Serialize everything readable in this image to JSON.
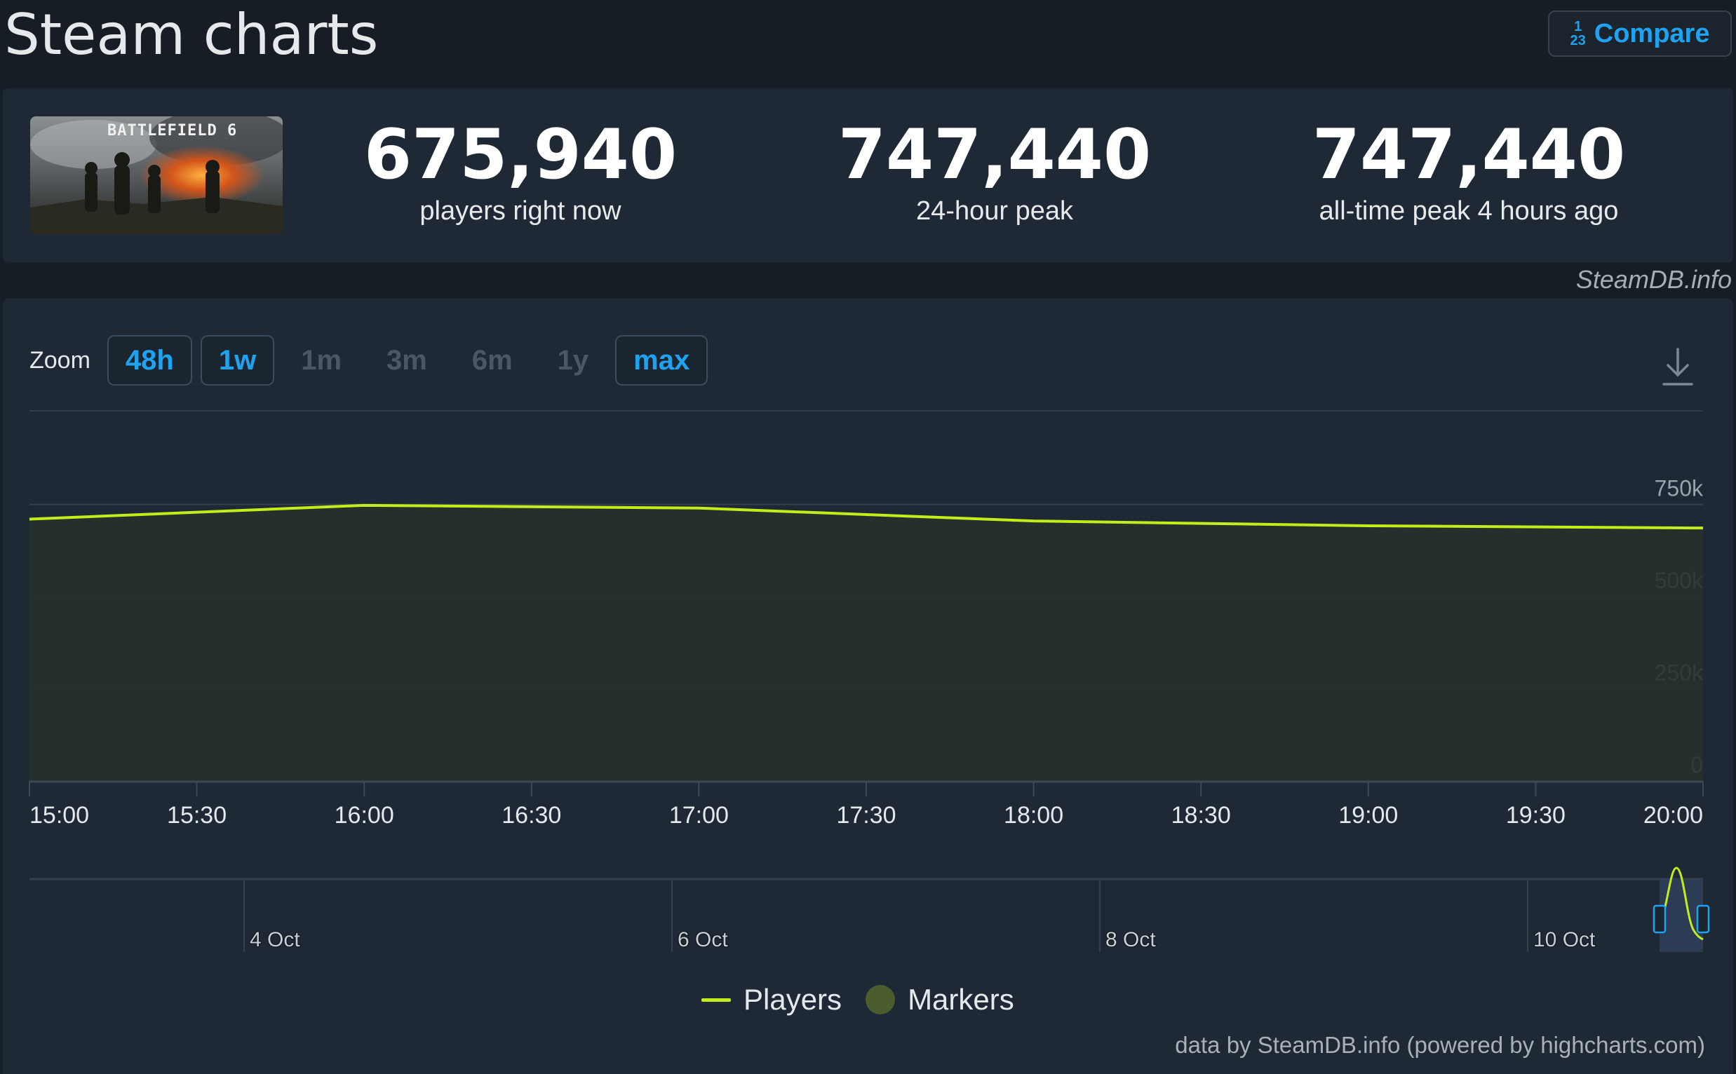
{
  "header": {
    "title": "Steam charts",
    "compare_label": "Compare",
    "compare_icon_top": "1",
    "compare_icon_bottom": "23"
  },
  "game": {
    "banner_text": "BATTLEFIELD 6"
  },
  "stats": [
    {
      "value": "675,940",
      "label": "players right now"
    },
    {
      "value": "747,440",
      "label": "24-hour peak"
    },
    {
      "value": "747,440",
      "label": "all-time peak 4 hours ago"
    }
  ],
  "watermark": "SteamDB.info",
  "zoom": {
    "label": "Zoom",
    "options": [
      {
        "label": "48h",
        "active": true
      },
      {
        "label": "1w",
        "active": true
      },
      {
        "label": "1m",
        "active": false
      },
      {
        "label": "3m",
        "active": false
      },
      {
        "label": "6m",
        "active": false
      },
      {
        "label": "1y",
        "active": false
      },
      {
        "label": "max",
        "active": true
      }
    ]
  },
  "icons": {
    "download": "download-icon",
    "compare": "compare-icon"
  },
  "colors": {
    "series": "#c3ec1b",
    "accent": "#1ea3f0",
    "markers": "#4b5d2e",
    "background": "#171d25",
    "panel": "#1e2935"
  },
  "chart_data": {
    "type": "area",
    "series": [
      {
        "name": "Players",
        "x": [
          "15:00",
          "16:00",
          "17:00",
          "18:00",
          "19:00",
          "20:00"
        ],
        "values": [
          710000,
          747440,
          740000,
          705000,
          692000,
          686000
        ]
      }
    ],
    "x_ticks": [
      "15:00",
      "15:30",
      "16:00",
      "16:30",
      "17:00",
      "17:30",
      "18:00",
      "18:30",
      "19:00",
      "19:30",
      "20:00"
    ],
    "y_ticks": [
      "750k",
      "500k",
      "250k",
      "0"
    ],
    "ylim": [
      0,
      1000000
    ],
    "navigator_labels": [
      "4 Oct",
      "6 Oct",
      "8 Oct",
      "10 Oct"
    ],
    "legend": [
      "Players",
      "Markers"
    ],
    "legend_position": "bottom-center",
    "grid": true
  },
  "credits": "data by SteamDB.info (powered by highcharts.com)"
}
